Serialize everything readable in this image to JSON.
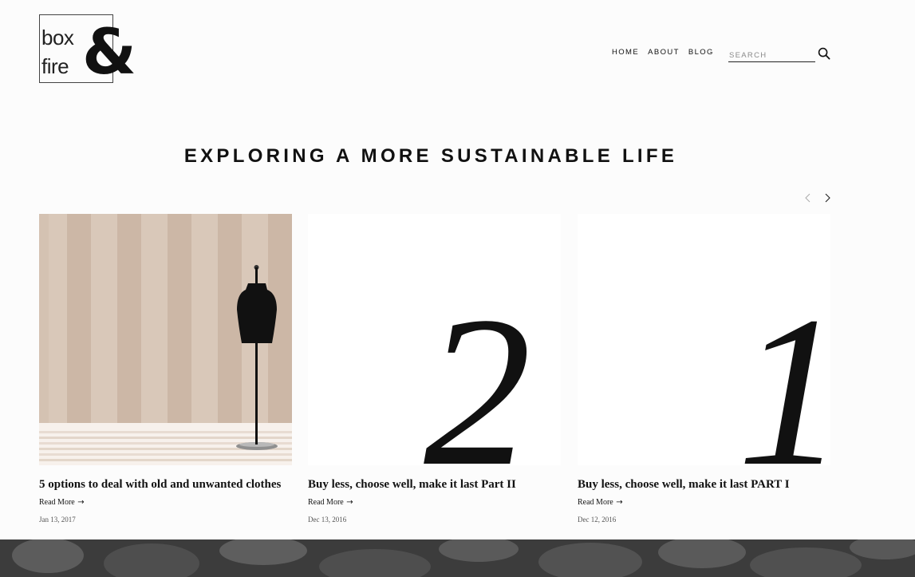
{
  "logo": {
    "word1": "box",
    "word2": "fire",
    "ampersand": "&"
  },
  "nav": {
    "items": [
      "HOME",
      "ABOUT",
      "BLOG"
    ]
  },
  "search": {
    "placeholder": "SEARCH",
    "icon": "search-icon"
  },
  "headline": "EXPLORING A MORE SUSTAINABLE LIFE",
  "carousel": {
    "prev_icon": "chevron-left-icon",
    "next_icon": "chevron-right-icon"
  },
  "posts": [
    {
      "title": "5 options to deal with old and unwanted clothes",
      "read_more": "Read More",
      "arrow": "→",
      "date": "Jan 13, 2017"
    },
    {
      "title": "Buy less, choose well, make it last Part II",
      "read_more": "Read More",
      "arrow": "→",
      "date": "Dec 13, 2016",
      "numeral": "2"
    },
    {
      "title": "Buy less, choose well, make it last PART I",
      "read_more": "Read More",
      "arrow": "→",
      "date": "Dec 12, 2016",
      "numeral": "1"
    }
  ],
  "colors": {
    "text": "#111111",
    "stripe_light": "#d9c8b9",
    "stripe_dark": "#ccb7a6",
    "footer": "#3c3c3c",
    "background": "#fcfcfc"
  }
}
